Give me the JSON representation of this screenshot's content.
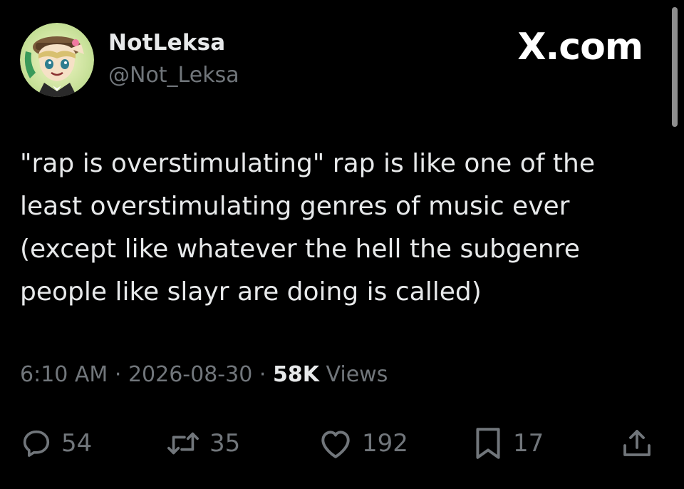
{
  "author": {
    "display_name": "NotLeksa",
    "handle": "@Not_Leksa",
    "avatar_icon": "avatar-icon"
  },
  "site": {
    "logo_text": "X.com"
  },
  "tweet": {
    "text_lines": [
      "\"rap is overstimulating\" rap is like one of the",
      "least overstimulating genres of music ever",
      "(except like whatever the hell the subgenre",
      "people like slayr are doing is called)"
    ],
    "time": "6:10 AM",
    "separator": "·",
    "date": "2026-08-30",
    "views_count": "58K",
    "views_label": "Views"
  },
  "actions": {
    "replies": {
      "icon": "reply-icon",
      "count": "54"
    },
    "reposts": {
      "icon": "repost-icon",
      "count": "35"
    },
    "likes": {
      "icon": "heart-icon",
      "count": "192"
    },
    "bookmarks": {
      "icon": "bookmark-icon",
      "count": "17"
    },
    "share": {
      "icon": "share-icon"
    }
  },
  "colors": {
    "background": "#000000",
    "primary_text": "#e7e9ea",
    "secondary_text": "#71767b"
  }
}
